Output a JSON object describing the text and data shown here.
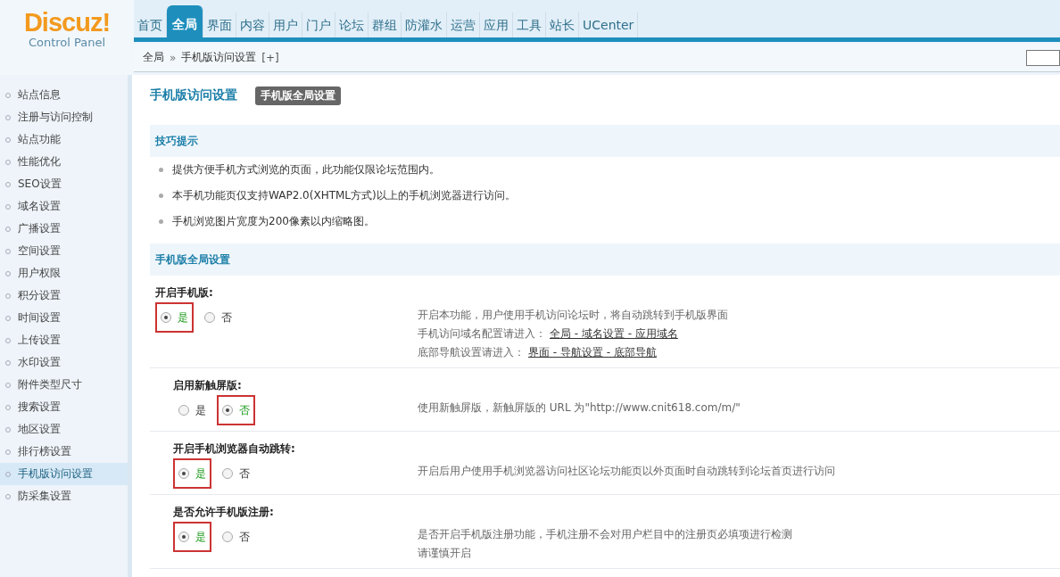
{
  "logo": {
    "brand": "Discuz!",
    "subtitle": "Control Panel"
  },
  "nav": [
    {
      "label": "首页",
      "selected": false
    },
    {
      "label": "全局",
      "selected": true
    },
    {
      "label": "界面",
      "selected": false
    },
    {
      "label": "内容",
      "selected": false
    },
    {
      "label": "用户",
      "selected": false
    },
    {
      "label": "门户",
      "selected": false
    },
    {
      "label": "论坛",
      "selected": false
    },
    {
      "label": "群组",
      "selected": false
    },
    {
      "label": "防灌水",
      "selected": false
    },
    {
      "label": "运营",
      "selected": false
    },
    {
      "label": "应用",
      "selected": false
    },
    {
      "label": "工具",
      "selected": false
    },
    {
      "label": "站长",
      "selected": false
    },
    {
      "label": "UCenter",
      "selected": false
    }
  ],
  "breadcrumb": {
    "parent": "全局",
    "separator": "»",
    "current": "手机版访问设置",
    "toggle": "[+]"
  },
  "sidebar": {
    "items": [
      {
        "label": "站点信息",
        "selected": false
      },
      {
        "label": "注册与访问控制",
        "selected": false
      },
      {
        "label": "站点功能",
        "selected": false
      },
      {
        "label": "性能优化",
        "selected": false
      },
      {
        "label": "SEO设置",
        "selected": false
      },
      {
        "label": "域名设置",
        "selected": false
      },
      {
        "label": "广播设置",
        "selected": false
      },
      {
        "label": "空间设置",
        "selected": false
      },
      {
        "label": "用户权限",
        "selected": false
      },
      {
        "label": "积分设置",
        "selected": false
      },
      {
        "label": "时间设置",
        "selected": false
      },
      {
        "label": "上传设置",
        "selected": false
      },
      {
        "label": "水印设置",
        "selected": false
      },
      {
        "label": "附件类型尺寸",
        "selected": false
      },
      {
        "label": "搜索设置",
        "selected": false
      },
      {
        "label": "地区设置",
        "selected": false
      },
      {
        "label": "排行榜设置",
        "selected": false
      },
      {
        "label": "手机版访问设置",
        "selected": true
      },
      {
        "label": "防采集设置",
        "selected": false
      }
    ]
  },
  "page": {
    "title": "手机版访问设置",
    "tabs": [
      {
        "label": "手机版全局设置",
        "selected": true
      }
    ]
  },
  "tips": {
    "heading": "技巧提示",
    "items": [
      "提供方便手机方式浏览的页面，此功能仅限论坛范围内。",
      "本手机功能页仅支持WAP2.0(XHTML方式)以上的手机浏览器进行访问。",
      "手机浏览图片宽度为200像素以内缩略图。"
    ]
  },
  "settings": {
    "heading": "手机版全局设置",
    "rows": [
      {
        "label": "开启手机版:",
        "nested": false,
        "options": [
          {
            "label": "是",
            "selected": true
          },
          {
            "label": "否",
            "selected": false
          }
        ],
        "description": [
          {
            "text": "开启本功能，用户使用手机访问论坛时，将自动跳转到手机版界面"
          },
          {
            "text": "手机访问域名配置请进入：",
            "link": "全局 - 域名设置 - 应用域名"
          },
          {
            "text": "底部导航设置请进入：",
            "link": "界面 - 导航设置 - 底部导航"
          }
        ]
      },
      {
        "label": "启用新触屏版:",
        "nested": true,
        "options": [
          {
            "label": "是",
            "selected": false
          },
          {
            "label": "否",
            "selected": true
          }
        ],
        "description": [
          {
            "text": "使用新触屏版，新触屏版的 URL 为\"http://www.cnit618.com/m/\""
          }
        ]
      },
      {
        "label": "开启手机浏览器自动跳转:",
        "nested": true,
        "options": [
          {
            "label": "是",
            "selected": true
          },
          {
            "label": "否",
            "selected": false
          }
        ],
        "description": [
          {
            "text": "开启后用户使用手机浏览器访问社区论坛功能页以外页面时自动跳转到论坛首页进行访问"
          }
        ]
      },
      {
        "label": "是否允许手机版注册:",
        "nested": true,
        "options": [
          {
            "label": "是",
            "selected": true
          },
          {
            "label": "否",
            "selected": false
          }
        ],
        "description": [
          {
            "text": "是否开启手机版注册功能，手机注册不会对用户栏目中的注册页必填项进行检测"
          },
          {
            "text": "请谨慎开启"
          }
        ]
      }
    ]
  }
}
